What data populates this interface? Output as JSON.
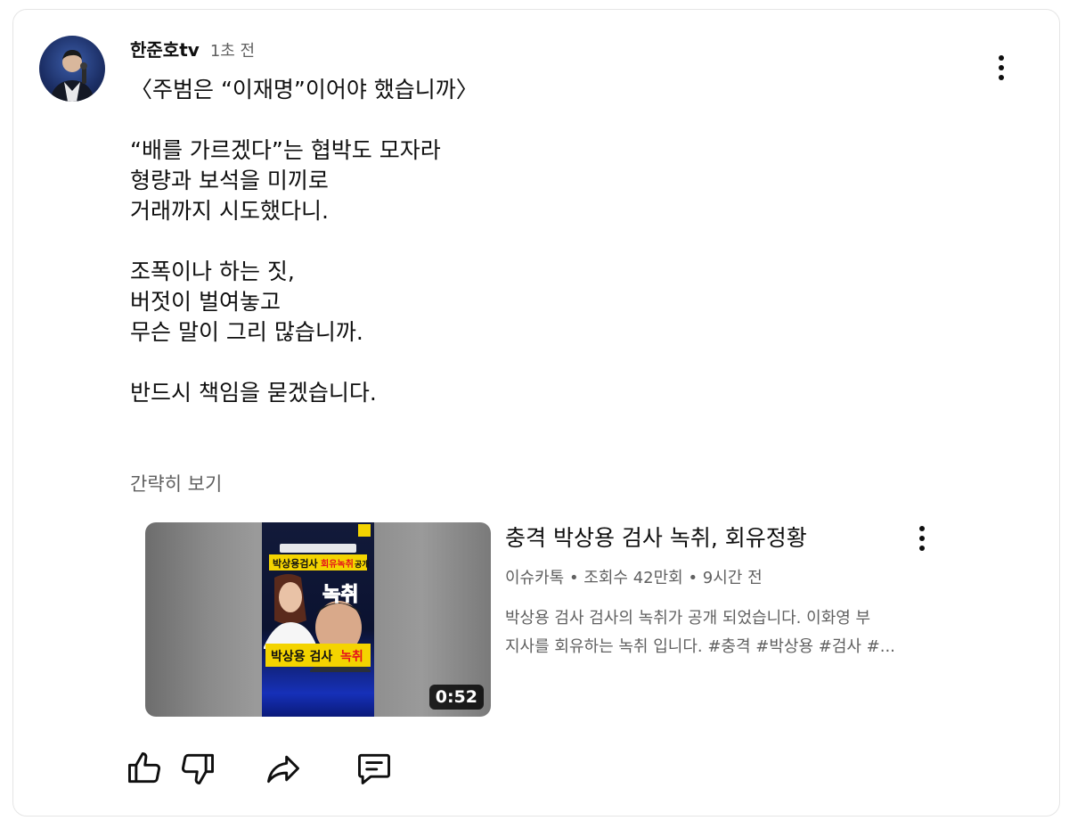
{
  "post": {
    "author": "한준호tv",
    "time": "1초 전",
    "lines": [
      "〈주범은 “이재명”이어야 했습니까〉",
      "",
      "“배를 가르겠다”는 협박도 모자라",
      "형량과 보석을 미끼로",
      "거래까지 시도했다니.",
      "",
      "조폭이나 하는 짓,",
      "버젓이 벌여놓고",
      "무슨 말이 그리 많습니까.",
      "",
      "반드시 책임을 묻겠습니다."
    ],
    "collapse_label": "간략히 보기"
  },
  "video": {
    "title": "충격 박상용 검사 녹취, 회유정황",
    "meta": "이슈카톡 • 조회수 42만회 • 9시간 전",
    "desc_line1": "박상용 검사 검사의 녹취가 공개 되었습니다. 이화영 부",
    "desc_line2": "지사를 회유하는 녹취 입니다. #충격 #박상용 #검사 #...",
    "duration": "0:52",
    "thumb_banner": "박상용 검사",
    "thumb_banner_accent": "녹취",
    "thumb_top_text": "박상용검사",
    "thumb_top_accent": "회유녹취",
    "thumb_top_suffix": "공개",
    "thumb_big_text": "녹취"
  },
  "actions": {
    "like_icon": "thumbs-up-icon",
    "dislike_icon": "thumbs-down-icon",
    "share_icon": "share-icon",
    "comment_icon": "comment-icon"
  },
  "colors": {
    "text_primary": "#0f0f0f",
    "text_secondary": "#606060",
    "thumb_banner": "#f4d400",
    "thumb_accent": "#e5131b"
  }
}
